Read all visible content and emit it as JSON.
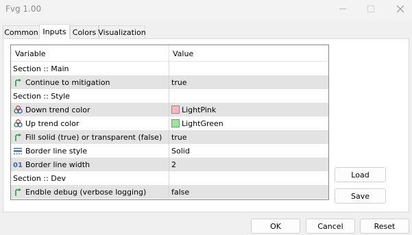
{
  "window": {
    "title": "Fvg 1.00"
  },
  "tabs": [
    {
      "label": "Common"
    },
    {
      "label": "Inputs"
    },
    {
      "label": "Colors"
    },
    {
      "label": "Visualization"
    }
  ],
  "active_tab": "Inputs",
  "grid": {
    "headers": {
      "variable": "Variable",
      "value": "Value"
    },
    "rows": [
      {
        "label": "Section :: Main",
        "value": "",
        "icon": "none"
      },
      {
        "label": "Continue to mitigation",
        "value": "true",
        "icon": "bool-arrow-icon"
      },
      {
        "label": "Section :: Style",
        "value": "",
        "icon": "none"
      },
      {
        "label": "Down trend color",
        "value": "LightPink",
        "icon": "color-circles-icon",
        "swatch": "#ffb6c1"
      },
      {
        "label": "Up trend color",
        "value": "LightGreen",
        "icon": "color-circles-icon",
        "swatch": "#90ee90"
      },
      {
        "label": "Fill solid (true) or transparent (false)",
        "value": "true",
        "icon": "bool-arrow-icon"
      },
      {
        "label": "Border line style",
        "value": "Solid",
        "icon": "line-style-icon"
      },
      {
        "label": "Border line width",
        "value": "2",
        "icon": "integer-icon"
      },
      {
        "label": "Section :: Dev",
        "value": "",
        "icon": "none"
      },
      {
        "label": "Endble debug (verbose logging)",
        "value": "false",
        "icon": "bool-arrow-icon"
      }
    ]
  },
  "side_buttons": {
    "load": "Load",
    "save": "Save"
  },
  "footer_buttons": {
    "ok": "OK",
    "cancel": "Cancel",
    "reset": "Reset"
  },
  "colors": {
    "bool_icon": "#1e9e3e",
    "integer_icon": "#2b6cb0",
    "line_style_icon": "#2b5fb0"
  }
}
